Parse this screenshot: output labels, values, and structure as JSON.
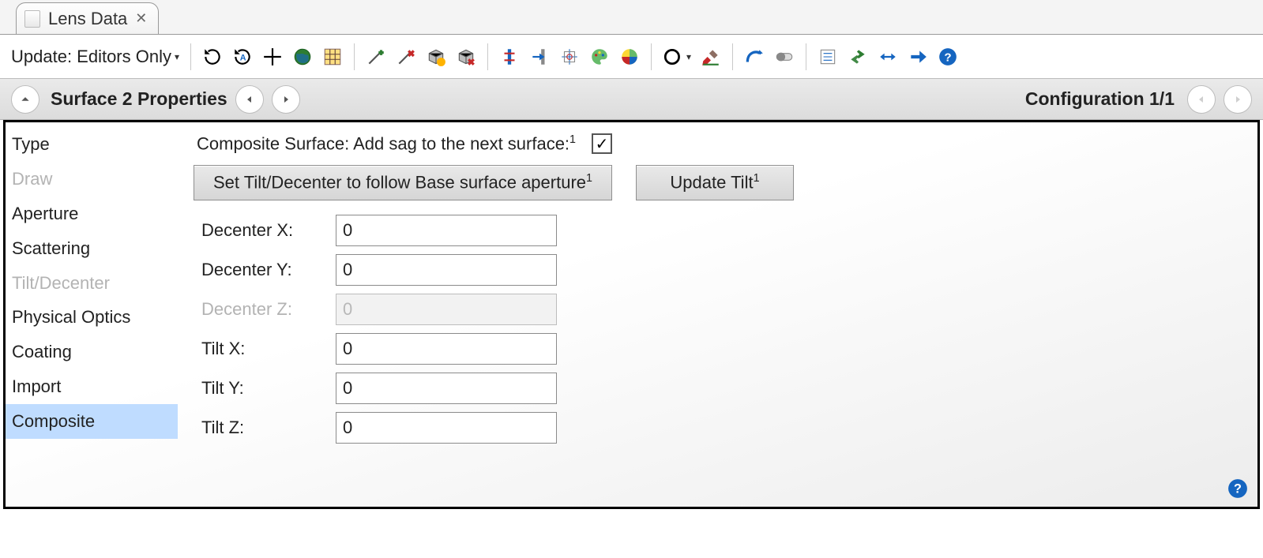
{
  "tab": {
    "title": "Lens Data"
  },
  "toolbar": {
    "update_label": "Update: Editors Only",
    "icons": [
      "refresh-icon",
      "auto-refresh-icon",
      "crosshair-icon",
      "globe-icon",
      "map-icon",
      "wizard-add-icon",
      "wizard-remove-icon",
      "package-warn-icon",
      "package-delete-icon",
      "align-vert-icon",
      "align-right-icon",
      "grid-align-icon",
      "palette-icon",
      "color-wheel-icon",
      "ring-icon",
      "paint-brush-icon",
      "curve-icon",
      "toggle-icon",
      "list-icon",
      "swap-icon",
      "resize-h-icon",
      "arrow-right-icon",
      "help-icon"
    ]
  },
  "header": {
    "surface_label": "Surface   2 Properties",
    "config_label": "Configuration 1/1"
  },
  "sidebar": {
    "items": [
      {
        "label": "Type",
        "state": "normal"
      },
      {
        "label": "Draw",
        "state": "disabled"
      },
      {
        "label": "Aperture",
        "state": "normal"
      },
      {
        "label": "Scattering",
        "state": "normal"
      },
      {
        "label": "Tilt/Decenter",
        "state": "disabled"
      },
      {
        "label": "Physical Optics",
        "state": "normal"
      },
      {
        "label": "Coating",
        "state": "normal"
      },
      {
        "label": "Import",
        "state": "normal"
      },
      {
        "label": "Composite",
        "state": "selected"
      }
    ]
  },
  "form": {
    "composite_label": "Composite Surface: Add sag to the next surface:",
    "composite_checked": true,
    "btn_set_tilt": "Set Tilt/Decenter to follow Base surface aperture",
    "btn_update_tilt": "Update Tilt",
    "fields": [
      {
        "label": "Decenter X:",
        "value": "0",
        "enabled": true
      },
      {
        "label": "Decenter Y:",
        "value": "0",
        "enabled": true
      },
      {
        "label": "Decenter Z:",
        "value": "0",
        "enabled": false
      },
      {
        "label": "Tilt X:",
        "value": "0",
        "enabled": true
      },
      {
        "label": "Tilt Y:",
        "value": "0",
        "enabled": true
      },
      {
        "label": "Tilt Z:",
        "value": "0",
        "enabled": true
      }
    ]
  }
}
